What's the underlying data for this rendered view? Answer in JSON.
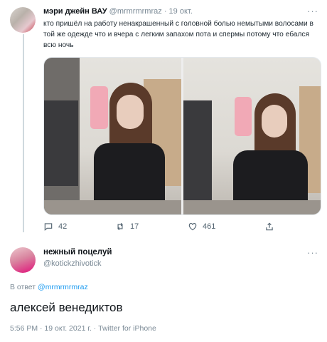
{
  "tweet": {
    "author_name": "мэри джейн ВАУ",
    "author_handle": "@mrmrmrmraz",
    "separator": "·",
    "date": "19 окт.",
    "more": "···",
    "text": "кто пришёл на работу ненакрашенный с головной болью немытыми волосами в той же одежде что и вчера с легким запахом пота и спермы потому что ебался всю ночь",
    "replies": "42",
    "retweets": "17",
    "likes": "461"
  },
  "reply": {
    "author_name": "нежный поцелуй",
    "author_handle": "@kotickzhivotick",
    "more": "···",
    "replying_prefix": "В ответ",
    "replying_to": "@mrmrmrmraz",
    "text": "алексей венедиктов",
    "timestamp": "5:56 PM · 19 окт. 2021 г. · Twitter for iPhone"
  },
  "colors": {
    "accent": "#1d9bf0",
    "muted": "#7b8a96",
    "text": "#0f1419",
    "phone_case": "#f1a9b6"
  },
  "icons": [
    "reply-icon",
    "retweet-icon",
    "like-icon",
    "share-icon",
    "more-icon"
  ]
}
